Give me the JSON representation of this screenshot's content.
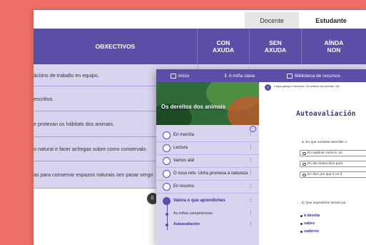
{
  "roles": {
    "docente": "Docente",
    "estudante": "Estudante"
  },
  "table": {
    "headers": {
      "objectives": "OBXECTIVOS",
      "con_axuda": "CON\nAXUDA",
      "sen_axuda": "SEN\nAXUDA",
      "ainda_non": "AÍNDA\nNON"
    },
    "rows": [
      "ácións de traballo en equipo.",
      "escritivo.",
      "e protexan os hábitats dos animais.",
      "o natural e facer achegas sobre como conservalo.",
      "as para conservar espazos naturais sen pasar vergo"
    ]
  },
  "nav": {
    "home": "Inicio",
    "class": "A miña clase",
    "library": "Biblioteca de recursos"
  },
  "sidebar": {
    "banner_title": "Os dereitos dos animais",
    "items": [
      {
        "label": "En marcha"
      },
      {
        "label": "Lectura"
      },
      {
        "label": "Vamos alá!"
      },
      {
        "label": "O noso reto. Unha promesa á natureza"
      },
      {
        "label": "En resumo"
      },
      {
        "label": "Valora o que aprendiches"
      }
    ],
    "subitems": [
      "As miñas competencias",
      "Autoavaliación"
    ]
  },
  "content": {
    "breadcrumb": "Lingua galega e Literatura  /  Os dereitos dos animais  /  Val",
    "heading": "Autoavaliación",
    "q1_num": "1.",
    "q1_text": "En que consiste describir u",
    "q1_options": [
      "En explicar como é, on",
      "En dar instrucións para",
      "En dicir por que é un d"
    ],
    "q2_num": "2.",
    "q2_text": "Que expresións serven pa",
    "q2_bullets": [
      "á  dereita",
      "sabes",
      "caderno"
    ]
  },
  "peek_button": "E"
}
